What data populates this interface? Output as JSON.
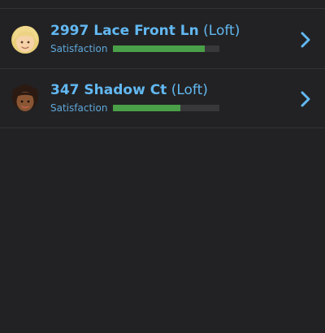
{
  "list": {
    "items": [
      {
        "address": "2997 Lace Front Ln",
        "type": "(Loft)",
        "satisfaction_label": "Satisfaction",
        "satisfaction_level": 0.86,
        "avatar_icon": "blonde-woman-avatar-icon",
        "arrow_icon": "chevron-right-icon"
      },
      {
        "address": "347 Shadow Ct",
        "type": "(Loft)",
        "satisfaction_label": "Satisfaction",
        "satisfaction_level": 0.63,
        "avatar_icon": "dark-hair-woman-avatar-icon",
        "arrow_icon": "chevron-right-icon"
      }
    ]
  },
  "colors": {
    "background": "#222224",
    "link_blue": "#62b8f2",
    "bar_fill": "#4aa048",
    "bar_track": "#38383b"
  }
}
